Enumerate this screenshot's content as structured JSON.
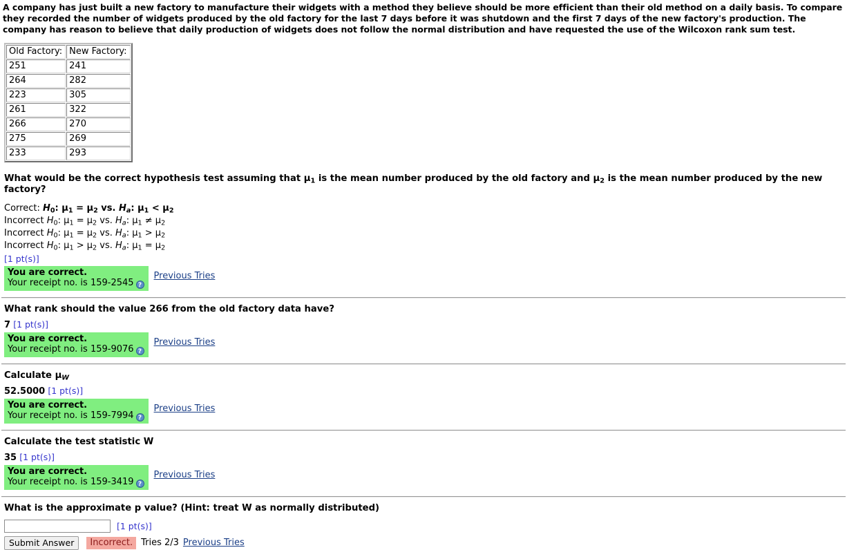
{
  "intro": {
    "text": "A company has just built a new factory to manufacture their widgets with a method they believe should be more efficient than their old method on a daily basis. To compare they recorded the number of widgets produced by the old factory for the last 7 days before it was shutdown and the first 7 days of the new factory's production. The company has reason to believe that daily production of widgets does not follow the normal distribution and have requested the use of the Wilcoxon rank sum test."
  },
  "data_table": {
    "headers": [
      "Old Factory:",
      "New Factory:"
    ],
    "rows": [
      [
        "251",
        "241"
      ],
      [
        "264",
        "282"
      ],
      [
        "223",
        "305"
      ],
      [
        "261",
        "322"
      ],
      [
        "266",
        "270"
      ],
      [
        "275",
        "269"
      ],
      [
        "233",
        "293"
      ]
    ]
  },
  "labels": {
    "points": "[1 pt(s)]",
    "previous_tries": "Previous Tries",
    "correct_title": "You are correct.",
    "receipt_prefix": "Your receipt no. is ",
    "help_glyph": "?",
    "submit_label": "Submit Answer",
    "incorrect_label": "Incorrect.",
    "tries_label": "Tries 2/3"
  },
  "questions": [
    {
      "id": "q1-hypothesis",
      "title_parts": {
        "a": "What would be the correct hypothesis test assuming that ",
        "mu1": "μ",
        "sub1": "1",
        "b": " is the mean number produced by the old factory and ",
        "mu2": "μ",
        "sub2": "2",
        "c": " is the mean number produced by the new factory?"
      },
      "title_plain": "What would be the correct hypothesis test assuming that μ1 is the mean number produced by the old factory and μ2 is the mean number produced by the new factory?",
      "foils": [
        {
          "lead": "Correct: ",
          "correct": true,
          "null_rel": "=",
          "alt_rel": "<"
        },
        {
          "lead": "Incorrect ",
          "correct": false,
          "null_rel": "=",
          "alt_rel": "≠"
        },
        {
          "lead": "Incorrect ",
          "correct": false,
          "null_rel": "=",
          "alt_rel": ">"
        },
        {
          "lead": "Incorrect ",
          "correct": false,
          "null_rel": ">",
          "alt_rel": "="
        }
      ],
      "answer": "",
      "points": "[1 pt(s)]",
      "status": "correct",
      "receipt": "159-2545"
    },
    {
      "id": "q2-rank",
      "title_plain": "What rank should the value 266 from the old factory data have?",
      "answer": "7",
      "points": "[1 pt(s)]",
      "status": "correct",
      "receipt": "159-9076"
    },
    {
      "id": "q3-mu-w",
      "title_plain": "Calculate μW",
      "title_prefix": "Calculate ",
      "title_mu": "μ",
      "title_sub": "W",
      "answer": "52.5000",
      "points": "[1 pt(s)]",
      "status": "correct",
      "receipt": "159-7994"
    },
    {
      "id": "q4-test-statistic",
      "title_plain": "Calculate the test statistic W",
      "answer": "35",
      "points": "[1 pt(s)]",
      "status": "correct",
      "receipt": "159-3419"
    },
    {
      "id": "q5-p-value",
      "title_plain": "What is the approximate p value? (Hint: treat W as normally distributed)",
      "input_value": "",
      "input_placeholder": "",
      "points": "[1 pt(s)]",
      "status": "incorrect",
      "tries": "Tries 2/3"
    }
  ],
  "colors": {
    "correct_green": "#80ee80",
    "incorrect_pink": "#f4a8a0",
    "points_blue": "#3333cc",
    "link_blue": "#1b3f87"
  }
}
